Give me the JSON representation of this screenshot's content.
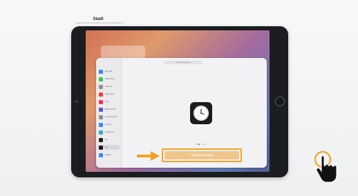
{
  "settings": {
    "search_placeholder": "Q Einstellungen",
    "sidebar": [
      {
        "label": "Bluetooth",
        "color": "#3a86ff"
      },
      {
        "label": "Mobile Daten",
        "color": "#34c759"
      },
      {
        "label": "Allgemein",
        "color": "#8e8e93"
      },
      {
        "label": "Mitteilungen",
        "color": "#ff3b30"
      },
      {
        "label": "Töne",
        "color": "#ff2d55"
      },
      {
        "label": "Bildschirmzeit",
        "color": "#5856d6"
      },
      {
        "label": "Kontrollzentrum",
        "color": "#8e8e93"
      },
      {
        "label": "Anzeige",
        "color": "#3a86ff"
      },
      {
        "label": "Hintergrund",
        "color": "#30b0c7"
      },
      {
        "label": "Siri",
        "color": "#1c1c1e"
      },
      {
        "label": "Uhr",
        "color": "#1c1c1e"
      },
      {
        "label": "Widgets",
        "color": "#3a86ff"
      }
    ],
    "selected_sidebar_index": 10
  },
  "widget_sheet": {
    "title": "Stadt",
    "subtitle": "Zeige die Uhrzeit einer Stadt auf deinem Home-Bildschirm an",
    "page_dots": 4,
    "active_dot": 1,
    "add_button_label": "+ Widget hinzufügen"
  },
  "colors": {
    "highlight": "#f3a321",
    "add_button": "#efc58a",
    "cursor": "#111111"
  },
  "icons": [
    "clock-icon",
    "arrow-right-icon",
    "hand-pointer-icon"
  ]
}
